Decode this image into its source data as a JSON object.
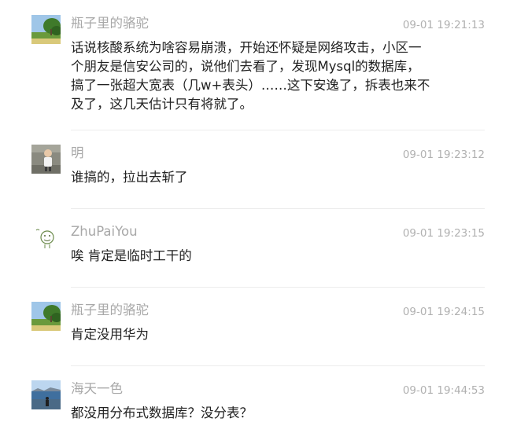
{
  "comments": [
    {
      "nickname": "瓶子里的骆驼",
      "time": "09-01 19:21:13",
      "avatar_icon": "landscape-photo-avatar",
      "text_lines": [
        "话说核酸系统为啥容易崩溃，开始还怀疑是网络攻击，小区一",
        "个朋友是信安公司的，说他们去看了，发现Mysql的数据库，",
        "搞了一张超大宽表（几w+表头）……这下安逸了，拆表也来不",
        "及了，这几天估计只有将就了。"
      ]
    },
    {
      "nickname": "明",
      "time": "09-01 19:23:12",
      "avatar_icon": "child-photo-avatar",
      "text_lines": [
        "谁搞的，拉出去斩了"
      ]
    },
    {
      "nickname": "ZhuPaiYou",
      "time": "09-01 19:23:15",
      "avatar_icon": "doodle-face-avatar",
      "text_lines": [
        "唉 肯定是临时工干的"
      ]
    },
    {
      "nickname": "瓶子里的骆驼",
      "time": "09-01 19:24:15",
      "avatar_icon": "landscape-photo-avatar",
      "text_lines": [
        "肯定没用华为"
      ]
    },
    {
      "nickname": "海天一色",
      "time": "09-01 19:44:53",
      "avatar_icon": "seaside-photo-avatar",
      "text_lines": [
        "都没用分布式数据库？没分表？"
      ]
    }
  ]
}
